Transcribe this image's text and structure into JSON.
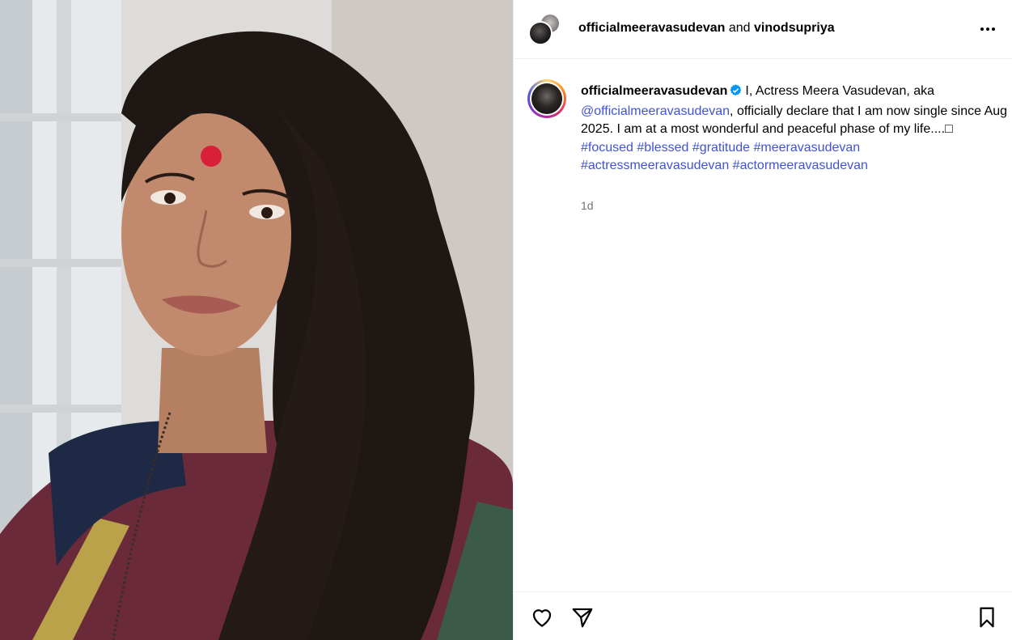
{
  "header": {
    "author": "officialmeeravasudevan",
    "joiner": "and",
    "coauthor": "vinodsupriya",
    "more_icon": "more-horizontal-icon"
  },
  "caption": {
    "username": "officialmeeravasudevan",
    "verified_icon": "verified-badge-icon",
    "text_1": "I, Actress Meera Vasudevan, aka",
    "mention": "@officialmeeravasudevan",
    "text_2": ", officially declare that I am now single since Aug 2025. I am at a most wonderful and peaceful phase of my life....□",
    "hashtags": [
      "#focused",
      "#blessed",
      "#gratitude",
      "#meeravasudevan",
      "#actressmeeravasudevan",
      "#actormeeravasudevan"
    ],
    "time": "1d"
  },
  "actions": {
    "like_icon": "heart-icon",
    "share_icon": "send-icon",
    "save_icon": "bookmark-icon"
  },
  "colors": {
    "link": "#4152d8",
    "muted": "#737373",
    "verified": "#0095f6",
    "border": "#efefef"
  }
}
